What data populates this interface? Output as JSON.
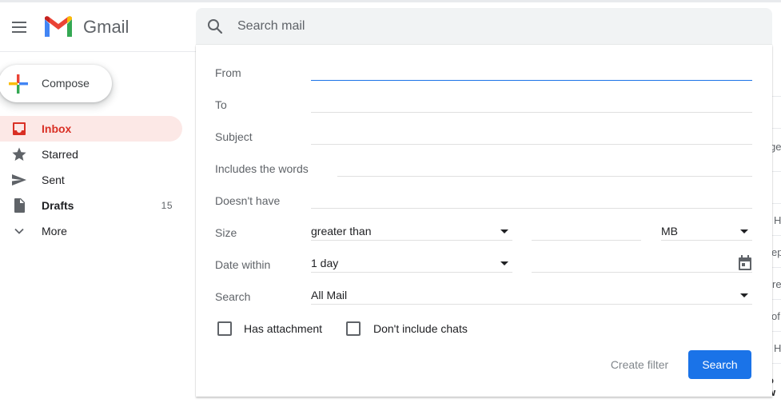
{
  "header": {
    "app_name": "Gmail",
    "search_placeholder": "Search mail"
  },
  "sidebar": {
    "compose_label": "Compose",
    "items": [
      {
        "label": "Inbox",
        "count": ""
      },
      {
        "label": "Starred",
        "count": ""
      },
      {
        "label": "Sent",
        "count": ""
      },
      {
        "label": "Drafts",
        "count": "15"
      },
      {
        "label": "More",
        "count": ""
      }
    ]
  },
  "advanced_search": {
    "from_label": "From",
    "from_value": "",
    "to_label": "To",
    "to_value": "",
    "subject_label": "Subject",
    "subject_value": "",
    "includes_label": "Includes the words",
    "includes_value": "",
    "doesnt_have_label": "Doesn't have",
    "doesnt_have_value": "",
    "size_label": "Size",
    "size_operator": "greater than",
    "size_value": "",
    "size_unit": "MB",
    "date_within_label": "Date within",
    "date_within_value": "1 day",
    "date_value": "",
    "search_scope_label": "Search",
    "search_scope_value": "All Mail",
    "has_attachment_label": "Has attachment",
    "has_attachment_checked": false,
    "dont_include_chats_label": "Don't include chats",
    "dont_include_chats_checked": false,
    "create_filter_label": "Create filter",
    "search_button_label": "Search"
  },
  "background_list_fragments": [
    "ge",
    "H",
    "ep",
    "re",
    "of",
    "H",
    "o w"
  ],
  "colors": {
    "accent_blue": "#1a73e8",
    "inbox_red": "#d93025",
    "inbox_highlight": "#fce8e6",
    "search_bar_bg": "#f1f3f4"
  }
}
